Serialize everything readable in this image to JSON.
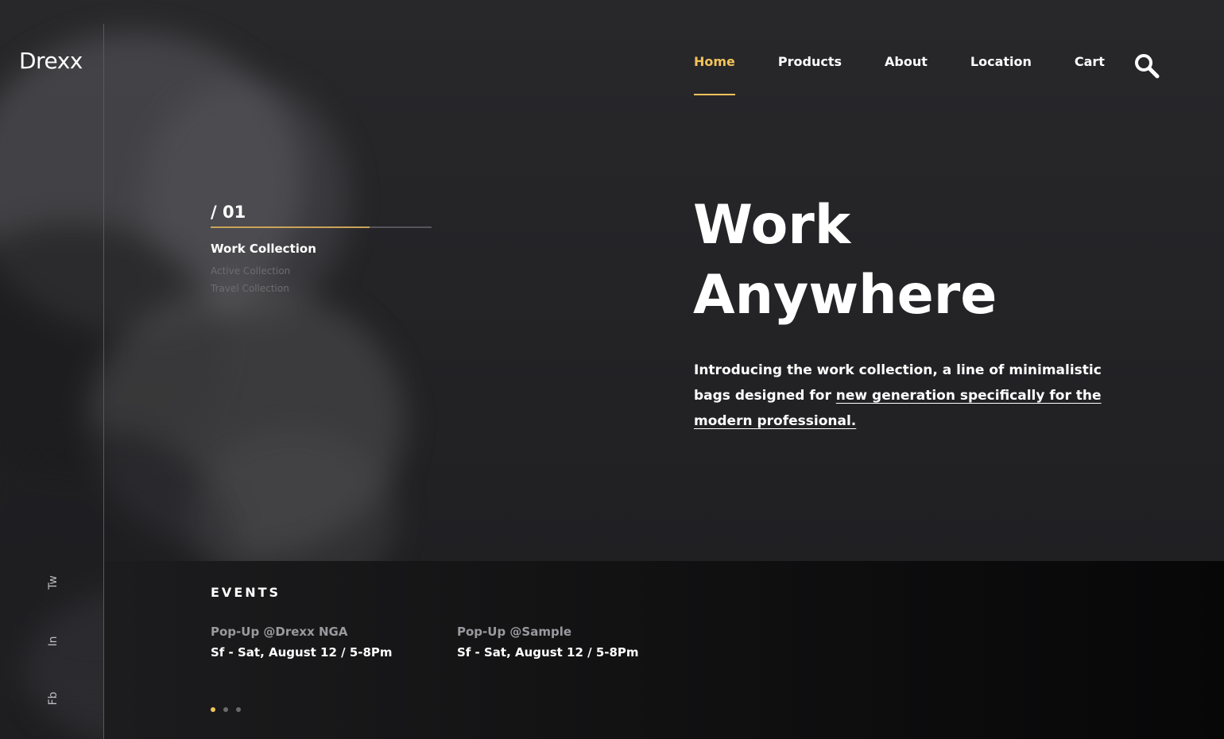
{
  "brand": {
    "logo": "Drexx"
  },
  "nav": {
    "items": [
      {
        "label": "Home",
        "active": true
      },
      {
        "label": "Products",
        "active": false
      },
      {
        "label": "About",
        "active": false
      },
      {
        "label": "Location",
        "active": false
      },
      {
        "label": "Cart",
        "active": false
      }
    ],
    "search_icon": "search-icon"
  },
  "slider": {
    "index": "/ 01",
    "progress": 0.72,
    "collections": {
      "current": "Work Collection",
      "others": [
        "Active Collection",
        "Travel Collection"
      ]
    }
  },
  "hero": {
    "title_line1": "Work",
    "title_line2": "Anywhere",
    "description": "Introducing the work collection, a line of minimalistic bags designed for",
    "description_link": "new generation specifically for the modern professional."
  },
  "events": {
    "title": "EVENTS",
    "items": [
      {
        "name": "Pop-Up @Drexx NGA",
        "date": "Sf - Sat, August 12 / 5-8Pm"
      },
      {
        "name": "Pop-Up @Sample",
        "date": "Sf - Sat, August 12 / 5-8Pm"
      }
    ],
    "pagination": {
      "total": 3,
      "current": 1
    }
  },
  "social": [
    "Tw",
    "In",
    "Fb"
  ],
  "colors": {
    "accent": "#f2c35b",
    "background": "#222225",
    "panel": "#121213",
    "muted_text": "#6d6d71"
  }
}
